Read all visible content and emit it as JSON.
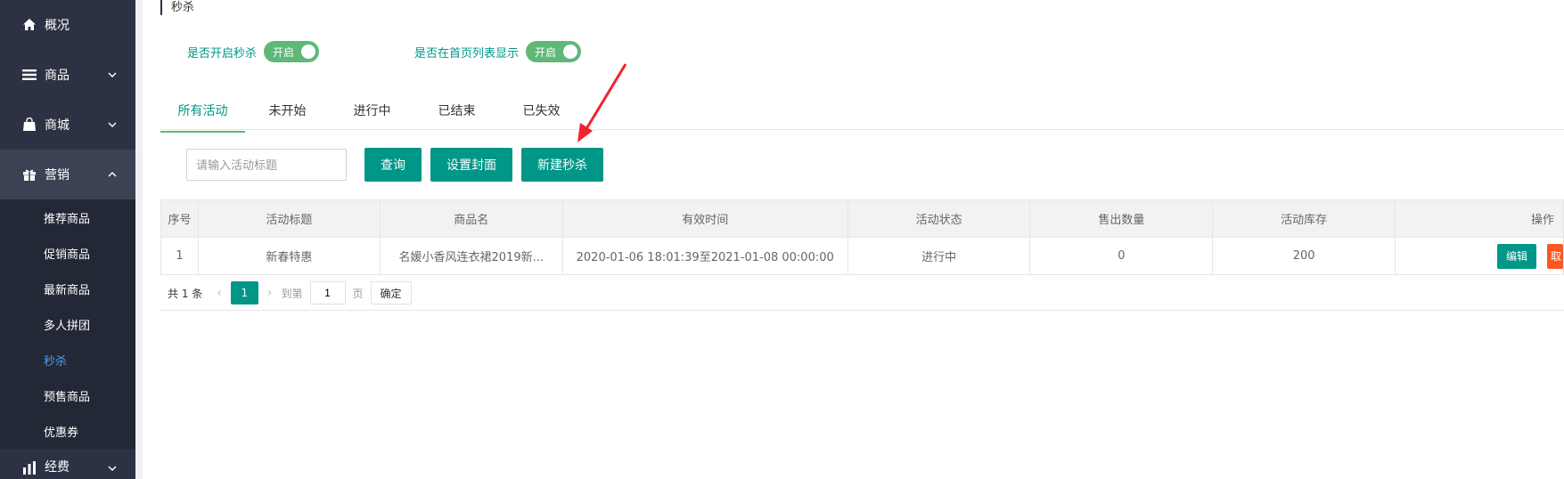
{
  "sidebar": {
    "groups": [
      {
        "label": "概况",
        "icon": "home-icon"
      },
      {
        "label": "商品",
        "icon": "list-icon"
      },
      {
        "label": "商城",
        "icon": "shopping-bag-icon"
      },
      {
        "label": "营销",
        "icon": "gift-icon"
      }
    ],
    "marketing_items": [
      "推荐商品",
      "促销商品",
      "最新商品",
      "多人拼团",
      "秒杀",
      "预售商品",
      "优惠券"
    ],
    "next_group": {
      "label": "经费",
      "icon": "chart-icon"
    },
    "active_color": "#4a9df8"
  },
  "breadcrumb": "秒杀",
  "settings": {
    "enable_label": "是否开启秒杀",
    "enable_switch": "开启",
    "homepage_label": "是否在首页列表显示",
    "homepage_switch": "开启"
  },
  "tabs": [
    "所有活动",
    "未开始",
    "进行中",
    "已结束",
    "已失效"
  ],
  "toolbar": {
    "search_placeholder": "请输入活动标题",
    "query_button": "查询",
    "cover_button": "设置封面",
    "new_button": "新建秒杀"
  },
  "table": {
    "headers": [
      "序号",
      "活动标题",
      "商品名",
      "有效时间",
      "活动状态",
      "售出数量",
      "活动库存",
      "操作"
    ],
    "rows": [
      {
        "index": "1",
        "title": "新春特惠",
        "product": "名媛小香风连衣裙2019新...",
        "period": "2020-01-06 18:01:39至2021-01-08 00:00:00",
        "status": "进行中",
        "sold": "0",
        "stock": "200",
        "edit": "编辑",
        "more": "取"
      }
    ]
  },
  "pager": {
    "total": "共 1 条",
    "current_page": "1",
    "goto_label": "到第",
    "page_input": "1",
    "page_unit": "页",
    "confirm": "确定"
  },
  "colors": {
    "primary": "#009688",
    "switch_on": "#5fb878",
    "danger": "#ff5722",
    "annotation_arrow": "#f5222d"
  }
}
